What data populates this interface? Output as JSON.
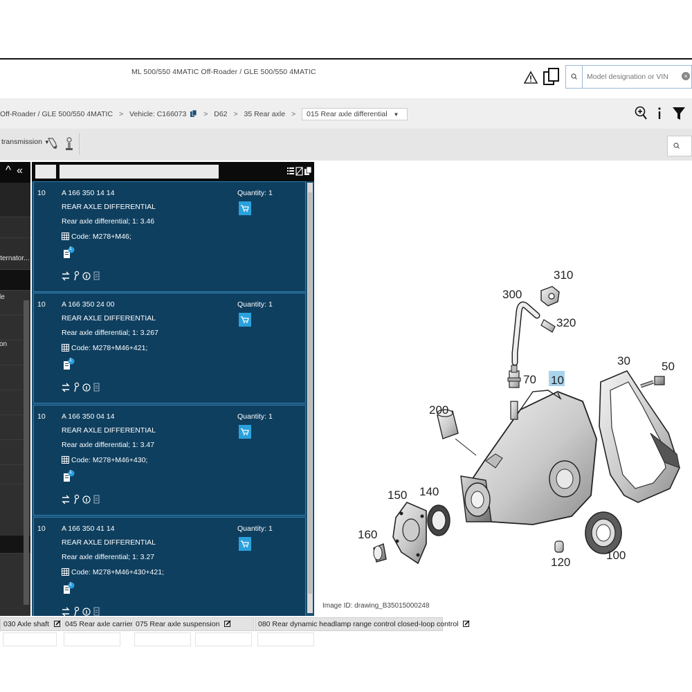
{
  "header": {
    "model_title": "ML 500/550 4MATIC Off-Roader / GLE 500/550 4MATIC",
    "search_placeholder": "Model designation or VIN"
  },
  "breadcrumb": {
    "model": "Off-Roader / GLE 500/550 4MATIC",
    "vehicle": "Vehicle: C166073",
    "group1": "D62",
    "group2": "35 Rear axle",
    "current": "015 Rear axle differential"
  },
  "toolbar": {
    "transmission_label": "transmission"
  },
  "leftnav": {
    "items": [
      "lternator...",
      "le",
      "on"
    ]
  },
  "parts": [
    {
      "pos": "10",
      "number": "A 166 350 14 14",
      "name": "REAR AXLE DIFFERENTIAL",
      "desc": "Rear axle differential; 1: 3.46",
      "code": "Code: M278+M46;",
      "qty": "Quantity: 1",
      "badge": "1"
    },
    {
      "pos": "10",
      "number": "A 166 350 24 00",
      "name": "REAR AXLE DIFFERENTIAL",
      "desc": "Rear axle differential; 1: 3.267",
      "code": "Code: M278+M46+421;",
      "qty": "Quantity: 1",
      "badge": "1"
    },
    {
      "pos": "10",
      "number": "A 166 350 04 14",
      "name": "REAR AXLE DIFFERENTIAL",
      "desc": "Rear axle differential; 1: 3.47",
      "code": "Code: M278+M46+430;",
      "qty": "Quantity: 1",
      "badge": "1"
    },
    {
      "pos": "10",
      "number": "A 166 350 41 14",
      "name": "REAR AXLE DIFFERENTIAL",
      "desc": "Rear axle differential; 1: 3.27",
      "code": "Code: M278+M46+430+421;",
      "qty": "Quantity: 1",
      "badge": "1"
    }
  ],
  "drawing": {
    "callouts": [
      "310",
      "300",
      "320",
      "70",
      "10",
      "30",
      "50",
      "200",
      "150",
      "140",
      "160",
      "120",
      "100"
    ],
    "image_id": "Image ID: drawing_B35015000248"
  },
  "bottom_tabs": [
    "030 Axle shaft",
    "045 Rear axle carrier",
    "075 Rear axle suspension",
    "080 Rear dynamic headlamp range control closed-loop control"
  ],
  "colors": {
    "parts_bg": "#0f3f5f",
    "parts_border": "#2e7fb3",
    "cart_accent": "#2aa1dc",
    "highlight_callout": "#a9d4ec"
  }
}
